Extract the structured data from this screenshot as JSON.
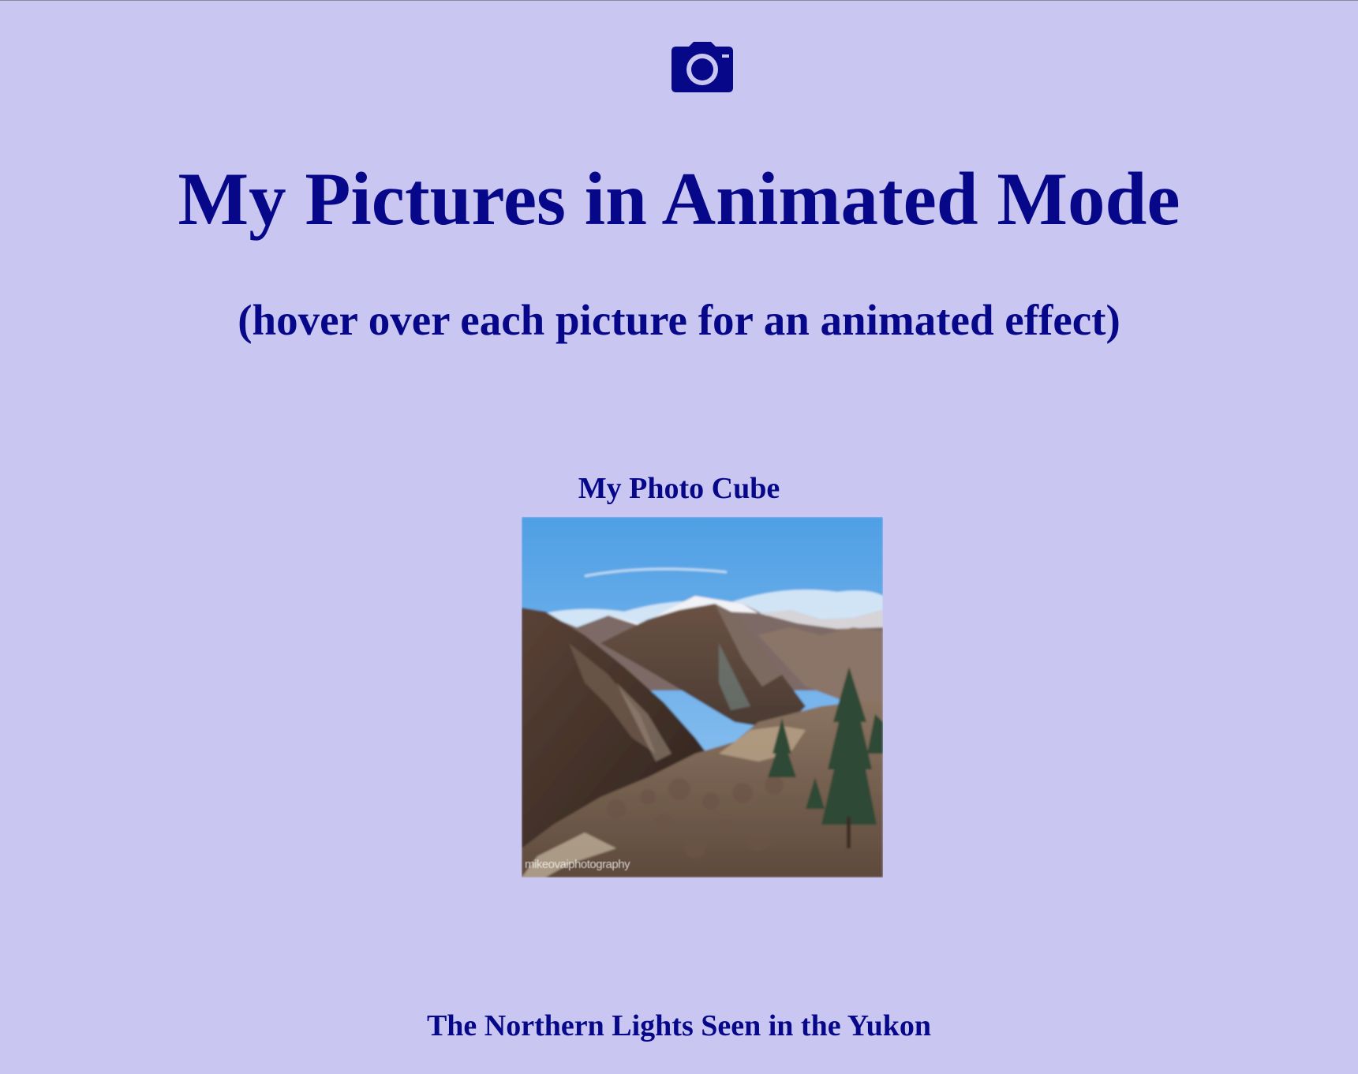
{
  "header": {
    "icon": "camera-icon",
    "title": "My Pictures in Animated Mode",
    "subtitle": "(hover over each picture for an animated effect)"
  },
  "gallery": {
    "section_title": "My Photo Cube",
    "photo": {
      "watermark": "mikeovaiphotography"
    }
  },
  "footer": {
    "caption": "The Northern Lights Seen in the Yukon"
  },
  "colors": {
    "background": "#c9c7f1",
    "text": "#07078a"
  }
}
